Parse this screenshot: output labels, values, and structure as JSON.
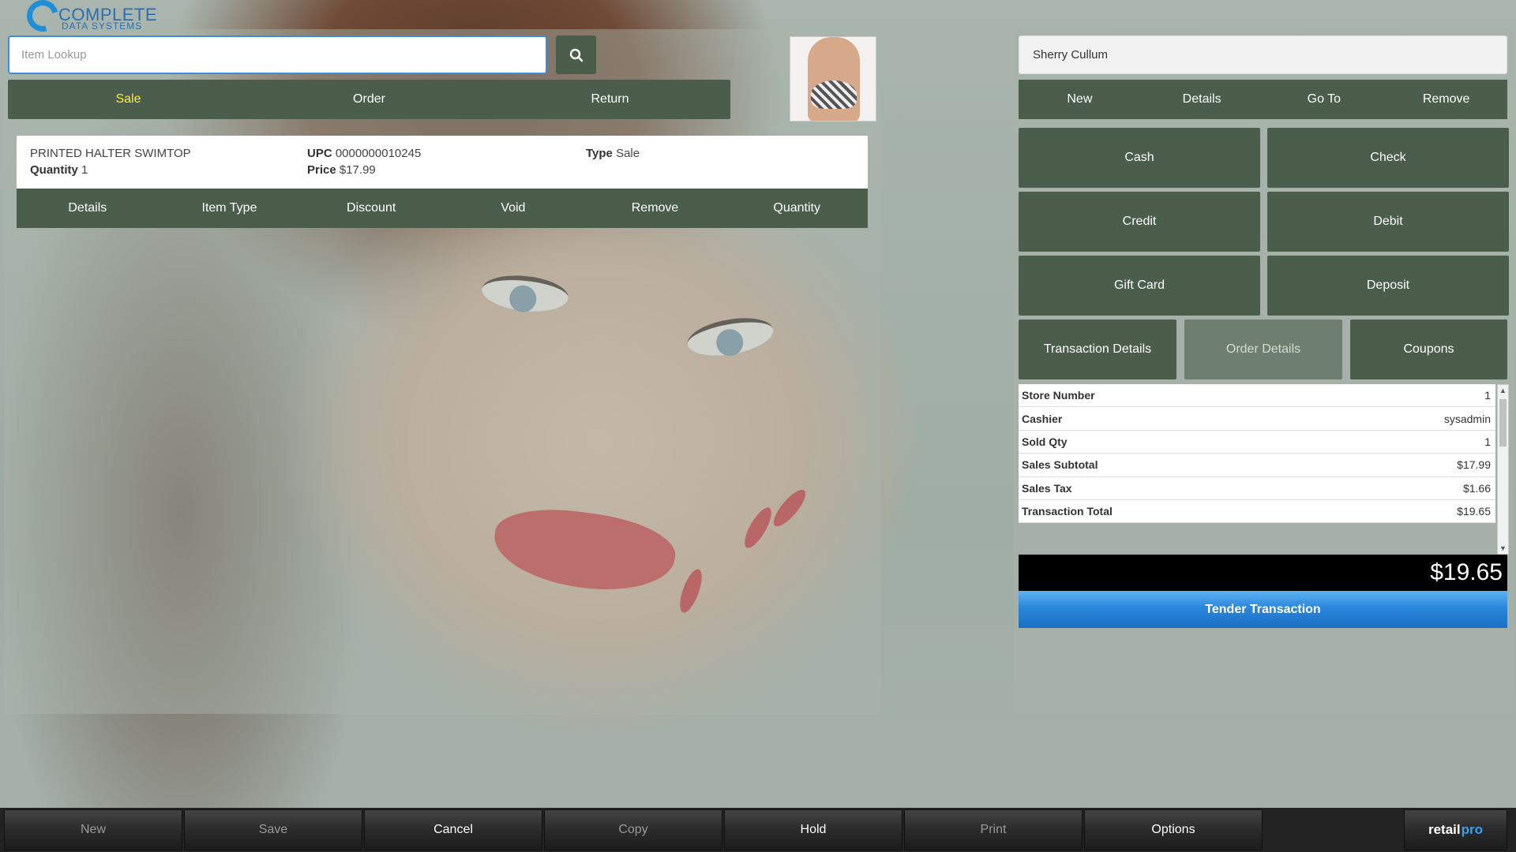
{
  "logo": {
    "line1": "COMPLETE",
    "line2": "DATA SYSTEMS"
  },
  "search": {
    "placeholder": "Item Lookup"
  },
  "mode_tabs": [
    {
      "label": "Sale",
      "active": true
    },
    {
      "label": "Order",
      "active": false
    },
    {
      "label": "Return",
      "active": false
    }
  ],
  "item": {
    "name": "PRINTED HALTER SWIMTOP",
    "quantity_label": "Quantity",
    "quantity": "1",
    "upc_label": "UPC",
    "upc": "0000000010245",
    "price_label": "Price",
    "price": "$17.99",
    "type_label": "Type",
    "type": "Sale"
  },
  "item_actions": [
    "Details",
    "Item Type",
    "Discount",
    "Void",
    "Remove",
    "Quantity"
  ],
  "customer": {
    "name": "Sherry Cullum"
  },
  "customer_actions": [
    "New",
    "Details",
    "Go To",
    "Remove"
  ],
  "payment_methods": [
    "Cash",
    "Check",
    "Credit",
    "Debit",
    "Gift Card",
    "Deposit"
  ],
  "detail_buttons": [
    {
      "label": "Transaction Details",
      "enabled": true
    },
    {
      "label": "Order Details",
      "enabled": false
    },
    {
      "label": "Coupons",
      "enabled": true
    }
  ],
  "summary": [
    {
      "key": "Store Number",
      "value": "1"
    },
    {
      "key": "Cashier",
      "value": "sysadmin"
    },
    {
      "key": "Sold Qty",
      "value": "1"
    },
    {
      "key": "Sales Subtotal",
      "value": "$17.99"
    },
    {
      "key": "Sales Tax",
      "value": "$1.66"
    },
    {
      "key": "Transaction Total",
      "value": "$19.65"
    }
  ],
  "total_display": "$19.65",
  "tender_label": "Tender Transaction",
  "bottom_actions": [
    {
      "label": "New",
      "enabled": false
    },
    {
      "label": "Save",
      "enabled": false
    },
    {
      "label": "Cancel",
      "enabled": true
    },
    {
      "label": "Copy",
      "enabled": false
    },
    {
      "label": "Hold",
      "enabled": true
    },
    {
      "label": "Print",
      "enabled": false
    },
    {
      "label": "Options",
      "enabled": true
    }
  ],
  "brand": {
    "part1": "retail",
    "part2": "pro"
  },
  "colors": {
    "button_green": "#4a5e4b",
    "active_tab": "#ffec3d",
    "tender_blue": "#2a87dc"
  }
}
